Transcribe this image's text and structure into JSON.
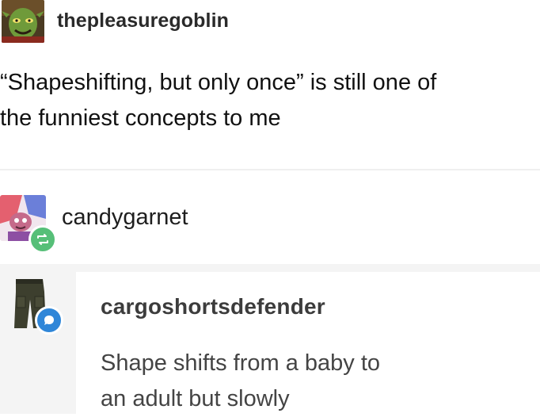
{
  "original_post": {
    "username": "thepleasuregoblin",
    "avatar_icon": "goblin-avatar-icon",
    "body_line1": "“Shapeshifting, but only once” is still one of",
    "body_line2": "the funniest concepts to me"
  },
  "reblog": {
    "username": "candygarnet",
    "avatar_icon": "gem-character-avatar-icon",
    "badge_icon": "reblog-icon",
    "badge_color": "#56bf78"
  },
  "reply": {
    "username": "cargoshortsdefender",
    "avatar_icon": "cargo-shorts-avatar-icon",
    "badge_icon": "message-bubble-icon",
    "badge_color": "#2f86d8",
    "text_line1": "Shape shifts from a baby to",
    "text_line2": "an adult but slowly"
  }
}
